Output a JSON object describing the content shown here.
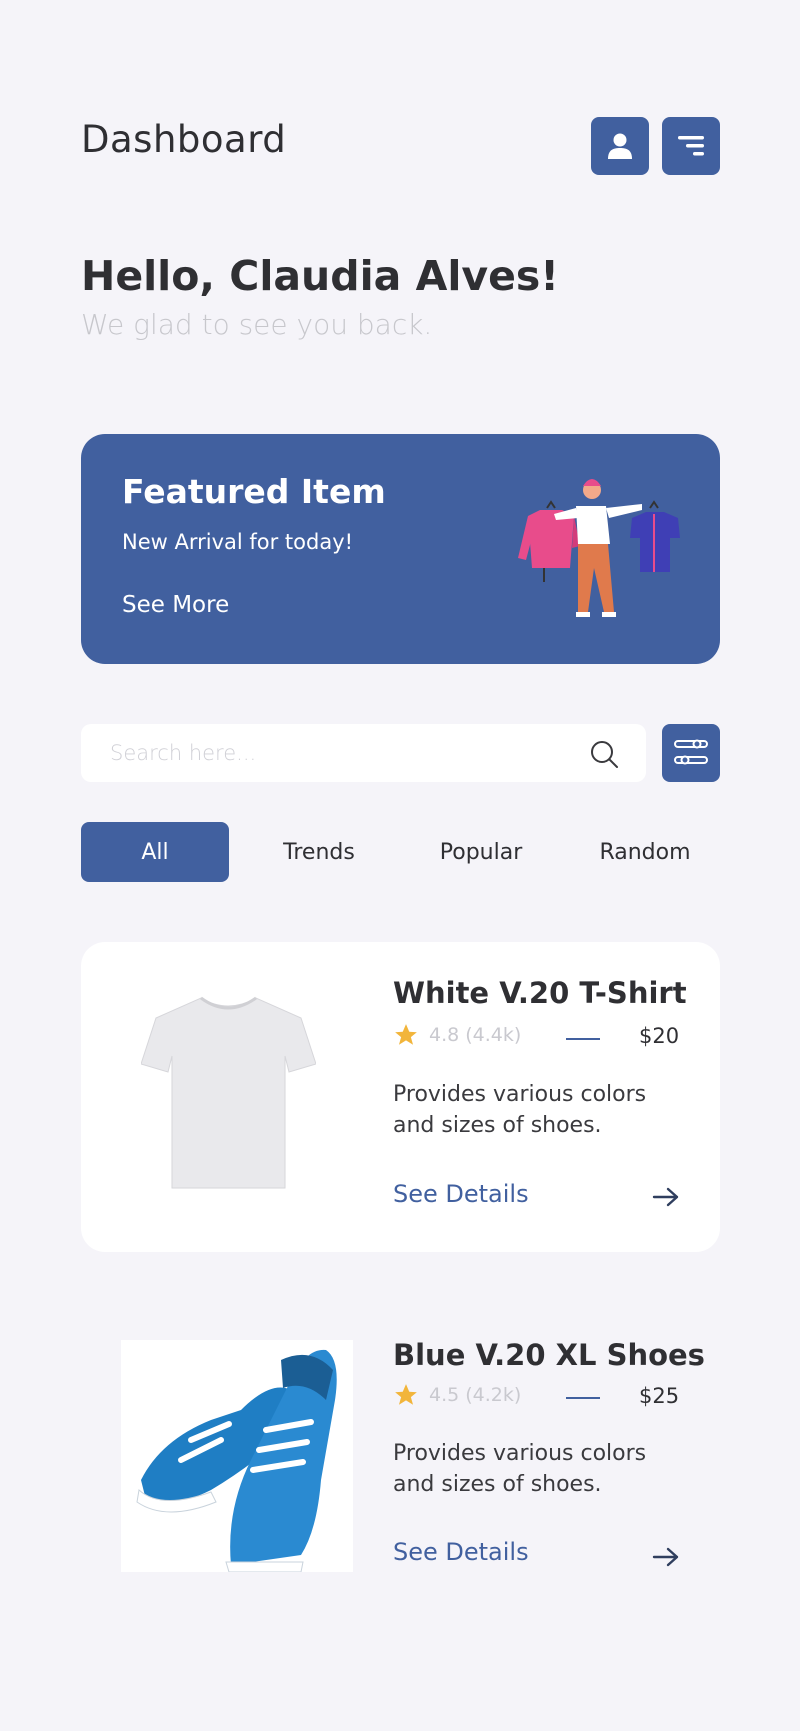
{
  "header": {
    "title": "Dashboard"
  },
  "greeting": {
    "title": "Hello, Claudia Alves!",
    "subtitle": "We glad to see you back."
  },
  "featured": {
    "title": "Featured Item",
    "subtitle": "New Arrival for today!",
    "link": "See More"
  },
  "search": {
    "placeholder": "Search here..."
  },
  "tabs": [
    {
      "label": "All",
      "active": true
    },
    {
      "label": "Trends",
      "active": false
    },
    {
      "label": "Popular",
      "active": false
    },
    {
      "label": "Random",
      "active": false
    }
  ],
  "products": [
    {
      "name": "White V.20 T-Shirt",
      "rating": "4.8 (4.4k)",
      "price": "$20",
      "description": "Provides various colors and sizes of shoes.",
      "link": "See Details"
    },
    {
      "name": "Blue V.20 XL Shoes",
      "rating": "4.5 (4.2k)",
      "price": "$25",
      "description": "Provides various colors and sizes of shoes.",
      "link": "See Details"
    }
  ],
  "colors": {
    "accent": "#41609f",
    "background": "#f5f4f9",
    "star": "#f2b53b"
  }
}
